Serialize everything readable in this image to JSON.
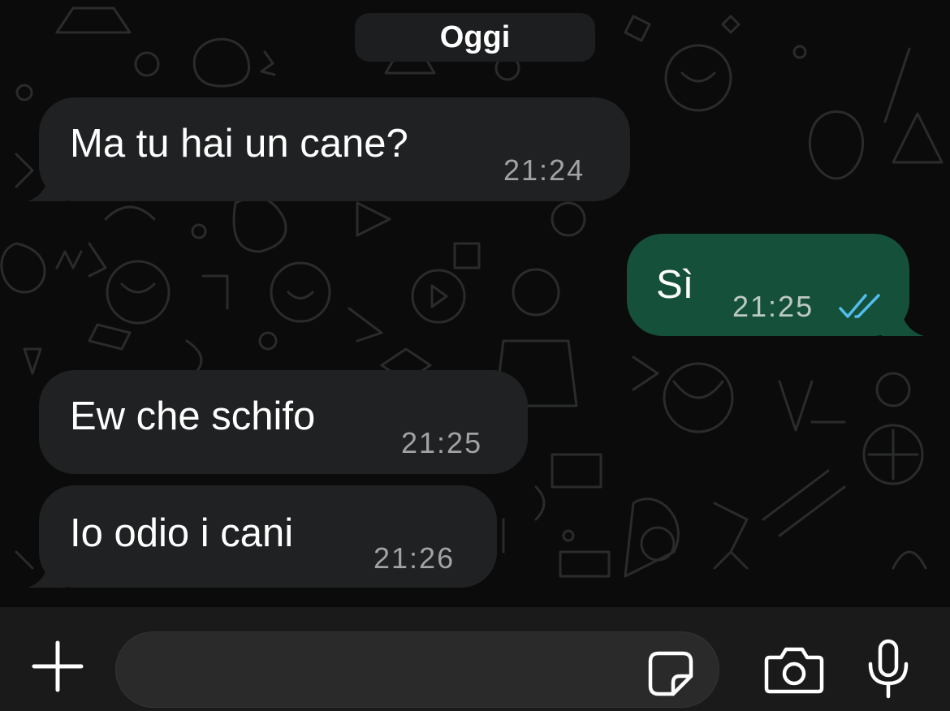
{
  "chat": {
    "date_divider": "Oggi",
    "messages": [
      {
        "direction": "incoming",
        "text": "Ma tu hai un cane?",
        "time": "21:24"
      },
      {
        "direction": "outgoing",
        "text": "Sì",
        "time": "21:25",
        "status": "read"
      },
      {
        "direction": "incoming",
        "text": "Ew che schifo",
        "time": "21:25"
      },
      {
        "direction": "incoming",
        "text": "Io odio i cani",
        "time": "21:26"
      }
    ]
  },
  "composer": {
    "message_value": "",
    "icons": {
      "attach": "plus-icon",
      "sticker": "sticker-icon",
      "camera": "camera-icon",
      "voice": "microphone-icon"
    }
  },
  "colors": {
    "background": "#0b0b0b",
    "incoming_bubble": "#202122",
    "outgoing_bubble": "#15503a",
    "read_ticks": "#53bdeb",
    "input_bar": "#1a1a1a"
  }
}
